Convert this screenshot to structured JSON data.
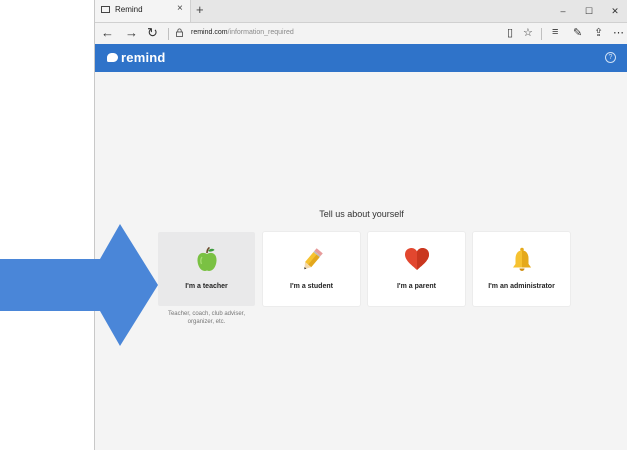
{
  "browser": {
    "tab_title": "Remind",
    "tab_close": "×",
    "new_tab": "+",
    "minimize": "–",
    "maximize": "☐",
    "close": "✕",
    "url_host": "remind.com",
    "url_path": "/information_required"
  },
  "app": {
    "logo_text": "remind",
    "help": "?",
    "accent": "#2f73c9"
  },
  "main": {
    "headline": "Tell us about yourself",
    "roles": [
      {
        "label": "I'm a teacher",
        "icon": "apple-icon",
        "selected": true
      },
      {
        "label": "I'm a student",
        "icon": "pencil-icon",
        "selected": false
      },
      {
        "label": "I'm a parent",
        "icon": "heart-icon",
        "selected": false
      },
      {
        "label": "I'm an administrator",
        "icon": "bell-icon",
        "selected": false
      }
    ],
    "teacher_caption": "Teacher, coach, club adviser, organizer, etc."
  },
  "overlay": {
    "arrow_color": "#4a86d8"
  }
}
